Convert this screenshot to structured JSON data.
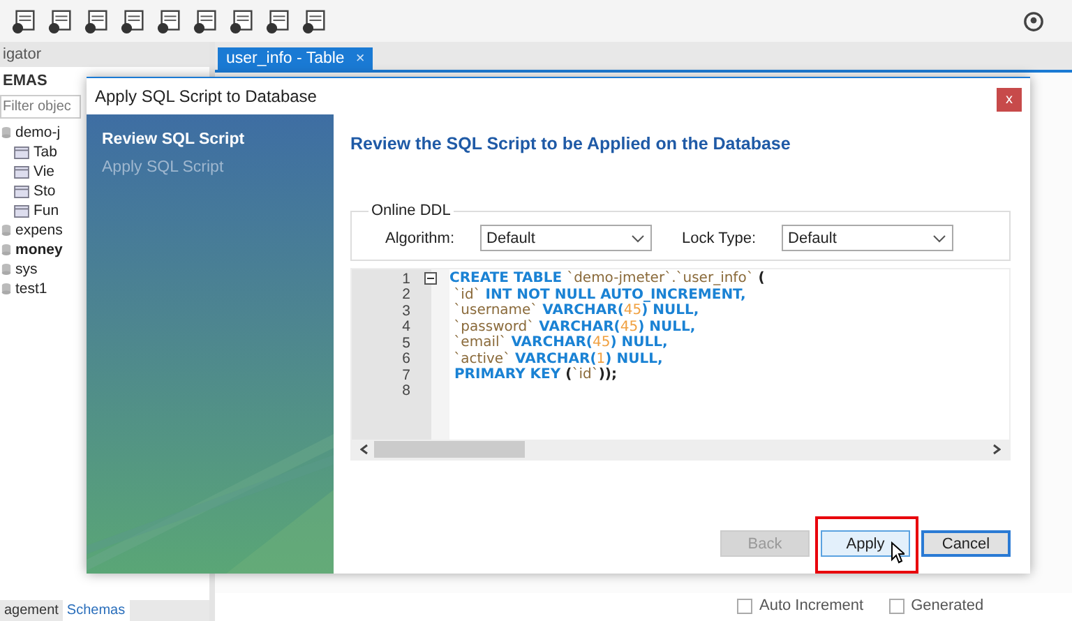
{
  "navigator": {
    "title": "igator",
    "section": "EMAS",
    "filter": {
      "placeholder": "Filter objec"
    },
    "schemas": [
      {
        "label": "demo-j",
        "active": false,
        "children": [
          {
            "label": "Tab"
          },
          {
            "label": "Vie"
          },
          {
            "label": "Sto"
          },
          {
            "label": "Fun"
          }
        ]
      },
      {
        "label": "expens",
        "active": false
      },
      {
        "label": "money",
        "active": true
      },
      {
        "label": "sys",
        "active": false
      },
      {
        "label": "test1",
        "active": false
      }
    ],
    "bottom_tabs": [
      {
        "label": "agement",
        "selected": false
      },
      {
        "label": "Schemas",
        "selected": true
      }
    ]
  },
  "editor_tab": {
    "label": "user_info - Table",
    "close": "×"
  },
  "column_options": [
    {
      "label": "Auto Increment",
      "checked": false
    },
    {
      "label": "Generated",
      "checked": false
    }
  ],
  "dialog": {
    "title": "Apply SQL Script to Database",
    "close": "x",
    "steps": [
      {
        "label": "Review SQL Script",
        "selected": true
      },
      {
        "label": "Apply SQL Script",
        "selected": false
      }
    ],
    "heading": "Review the SQL Script to be Applied on the Database",
    "online_ddl": {
      "title": "Online DDL",
      "algorithm": {
        "label": "Algorithm:",
        "value": "Default"
      },
      "lock_type": {
        "label": "Lock Type:",
        "value": "Default"
      }
    },
    "script_lines": [
      {
        "number": "1",
        "tokens": [
          {
            "kind": "keyword",
            "text": "CREATE TABLE "
          },
          {
            "kind": "ident",
            "text": "`demo-jmeter`.`user_info`"
          },
          {
            "kind": "plain",
            "text": " ("
          }
        ]
      },
      {
        "number": "2",
        "tokens": [
          {
            "kind": "ident",
            "text": " `id`"
          },
          {
            "kind": "keyword",
            "text": " INT NOT NULL AUTO_INCREMENT,"
          }
        ]
      },
      {
        "number": "3",
        "tokens": [
          {
            "kind": "ident",
            "text": " `username`"
          },
          {
            "kind": "keyword",
            "text": " VARCHAR("
          },
          {
            "kind": "number",
            "text": "45"
          },
          {
            "kind": "keyword",
            "text": ") NULL,"
          }
        ]
      },
      {
        "number": "4",
        "tokens": [
          {
            "kind": "ident",
            "text": " `password`"
          },
          {
            "kind": "keyword",
            "text": " VARCHAR("
          },
          {
            "kind": "number",
            "text": "45"
          },
          {
            "kind": "keyword",
            "text": ") NULL,"
          }
        ]
      },
      {
        "number": "5",
        "tokens": [
          {
            "kind": "ident",
            "text": " `email`"
          },
          {
            "kind": "keyword",
            "text": " VARCHAR("
          },
          {
            "kind": "number",
            "text": "45"
          },
          {
            "kind": "keyword",
            "text": ") NULL,"
          }
        ]
      },
      {
        "number": "6",
        "tokens": [
          {
            "kind": "ident",
            "text": " `active`"
          },
          {
            "kind": "keyword",
            "text": " VARCHAR("
          },
          {
            "kind": "number",
            "text": "1"
          },
          {
            "kind": "keyword",
            "text": ") NULL,"
          }
        ]
      },
      {
        "number": "7",
        "tokens": [
          {
            "kind": "keyword",
            "text": " PRIMARY KEY"
          },
          {
            "kind": "plain",
            "text": " ("
          },
          {
            "kind": "ident",
            "text": "`id`"
          },
          {
            "kind": "plain",
            "text": "));"
          }
        ]
      },
      {
        "number": "8"
      }
    ],
    "buttons": [
      {
        "label": "Back",
        "disabled": true,
        "hovered": false,
        "default_button": false,
        "highlighted": false
      },
      {
        "label": "Apply",
        "disabled": false,
        "hovered": true,
        "default_button": false,
        "highlighted": true
      },
      {
        "label": "Cancel",
        "disabled": false,
        "hovered": false,
        "default_button": true,
        "highlighted": false
      }
    ]
  }
}
